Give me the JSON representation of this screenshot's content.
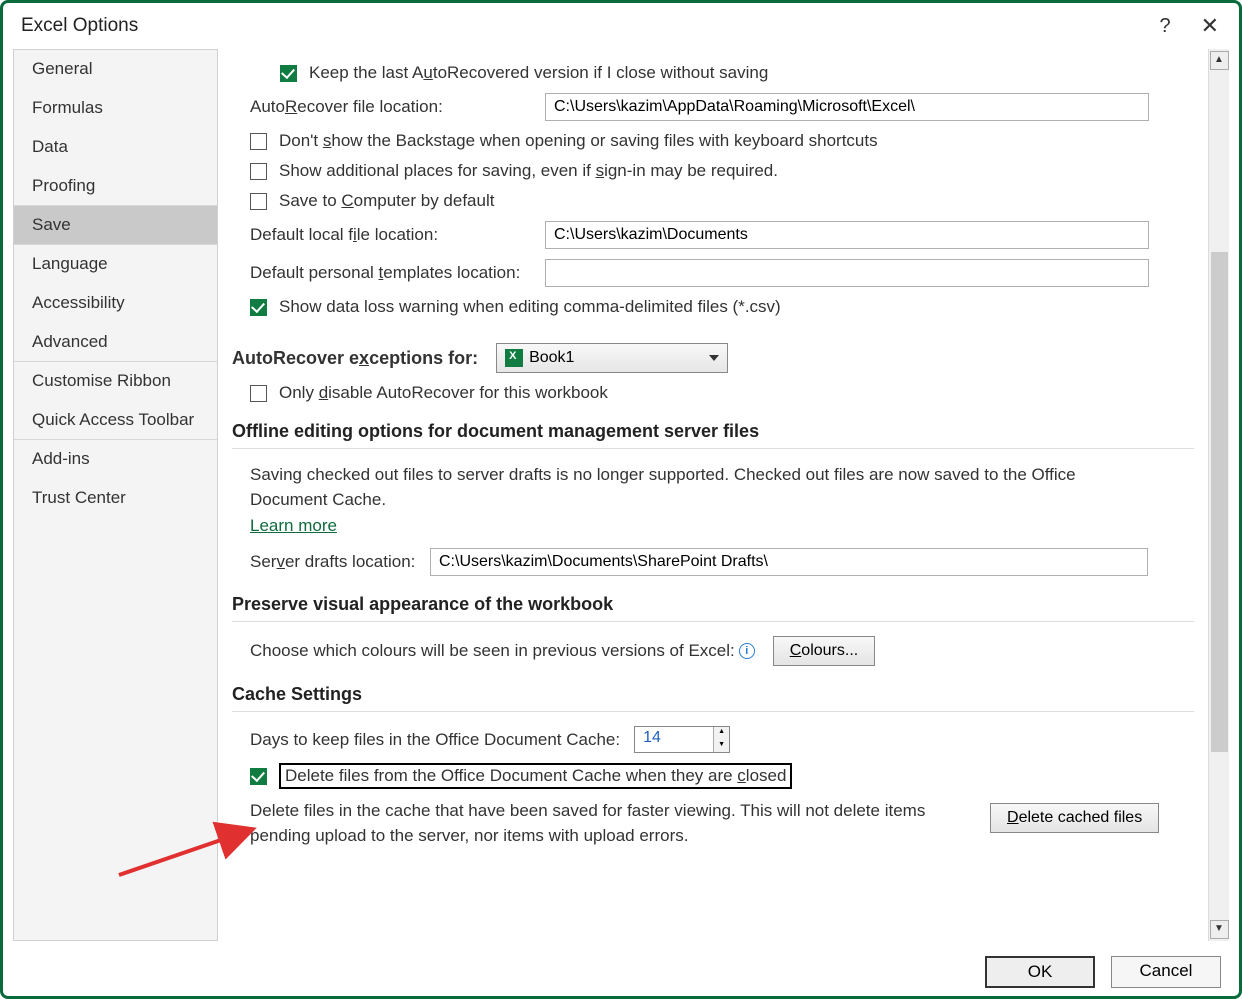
{
  "title": "Excel Options",
  "sidebar": {
    "items": [
      {
        "label": "General"
      },
      {
        "label": "Formulas"
      },
      {
        "label": "Data"
      },
      {
        "label": "Proofing"
      },
      {
        "label": "Save"
      },
      {
        "label": "Language"
      },
      {
        "label": "Accessibility"
      },
      {
        "label": "Advanced"
      },
      {
        "label": "Customise Ribbon"
      },
      {
        "label": "Quick Access Toolbar"
      },
      {
        "label": "Add-ins"
      },
      {
        "label": "Trust Center"
      }
    ]
  },
  "save": {
    "keep_last_label_pre": "Keep the last A",
    "keep_last_label_u": "u",
    "keep_last_label_post": "toRecovered version if I close without saving",
    "autorecover_loc_label_pre": "Auto",
    "autorecover_loc_label_u": "R",
    "autorecover_loc_label_post": "ecover file location:",
    "autorecover_loc_value": "C:\\Users\\kazim\\AppData\\Roaming\\Microsoft\\Excel\\",
    "dont_show_pre": "Don't ",
    "dont_show_u": "s",
    "dont_show_post": "how the Backstage when opening or saving files with keyboard shortcuts",
    "show_additional_pre": "Show additional places for saving, even if ",
    "show_additional_u": "s",
    "show_additional_post": "ign-in may be required.",
    "save_computer_pre": "Save to ",
    "save_computer_u": "C",
    "save_computer_post": "omputer by default",
    "default_local_pre": "Default local f",
    "default_local_u": "i",
    "default_local_post": "le location:",
    "default_local_value": "C:\\Users\\kazim\\Documents",
    "default_templates_pre": "Default personal ",
    "default_templates_u": "t",
    "default_templates_post": "emplates location:",
    "default_templates_value": "",
    "show_csv_warning": "Show data loss warning when editing comma-delimited files (*.csv)",
    "exceptions_pre": "AutoRecover e",
    "exceptions_u": "x",
    "exceptions_post": "ceptions for:",
    "exceptions_book": "Book1",
    "only_disable_pre": "Only ",
    "only_disable_u": "d",
    "only_disable_post": "isable AutoRecover for this workbook",
    "offline_header": "Offline editing options for document management server files",
    "offline_desc": "Saving checked out files to server drafts is no longer supported. Checked out files are now saved to the Office Document Cache.",
    "learn_more": "Learn more",
    "server_drafts_pre": "Ser",
    "server_drafts_u": "v",
    "server_drafts_post": "er drafts location:",
    "server_drafts_value": "C:\\Users\\kazim\\Documents\\SharePoint Drafts\\",
    "preserve_header": "Preserve visual appearance of the workbook",
    "colours_desc": "Choose which colours will be seen in previous versions of Excel:",
    "colours_btn_u": "C",
    "colours_btn_post": "olours...",
    "cache_header": "Cache Settings",
    "days_keep": "Days to keep files in the Office Document Cache:",
    "days_value": "14",
    "delete_closed_pre": "Delete files from the Office Document Cache when they are ",
    "delete_closed_u": "c",
    "delete_closed_post": "losed",
    "delete_desc": "Delete files in the cache that have been saved for faster viewing. This will not delete items pending upload to the server, nor items with upload errors.",
    "delete_btn_u": "D",
    "delete_btn_post": "elete cached files"
  },
  "footer": {
    "ok": "OK",
    "cancel": "Cancel"
  }
}
